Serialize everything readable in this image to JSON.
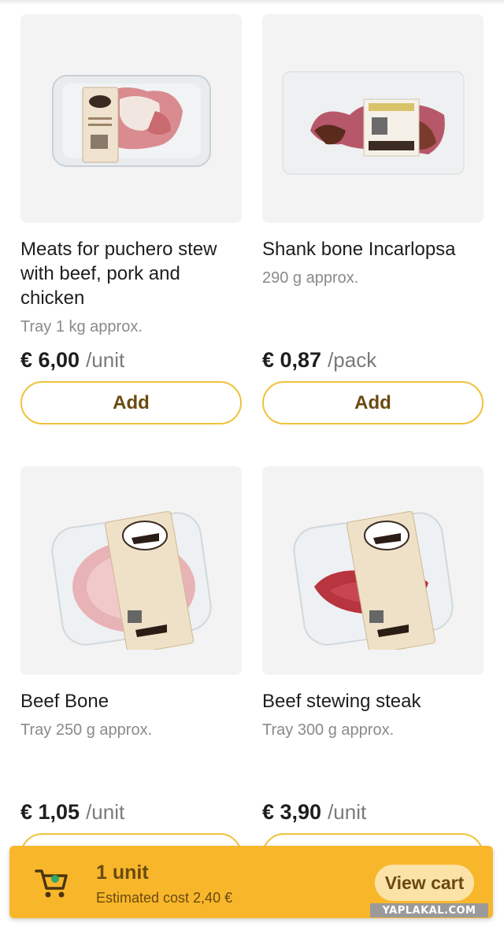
{
  "products": [
    {
      "name": "Meats for puchero stew with beef, pork and chicken",
      "meta": "Tray 1 kg approx.",
      "price": "€ 6,00",
      "unit": "/unit",
      "add_label": "Add",
      "image": "meat-tray-image"
    },
    {
      "name": "Shank bone Incarlopsa",
      "meta": "290 g approx.",
      "price": "€ 0,87",
      "unit": "/pack",
      "add_label": "Add",
      "image": "shank-bone-pack-image"
    },
    {
      "name": "Beef Bone",
      "meta": "Tray 250 g approx.",
      "price": "€ 1,05",
      "unit": "/unit",
      "image": "beef-bone-tray-image"
    },
    {
      "name": "Beef stewing steak",
      "meta": "Tray 300 g approx.",
      "price": "€ 3,90",
      "unit": "/unit",
      "image": "beef-steak-tray-image"
    }
  ],
  "cart": {
    "count_text": "1 unit",
    "estimate_text": "Estimated cost 2,40 €",
    "view_cart_label": "View cart",
    "icon": "cart-icon"
  },
  "watermark": "YAPLAKAL.COM",
  "colors": {
    "accent": "#f8b72b",
    "button_border": "#f0c23a",
    "button_text": "#6b4a10"
  }
}
